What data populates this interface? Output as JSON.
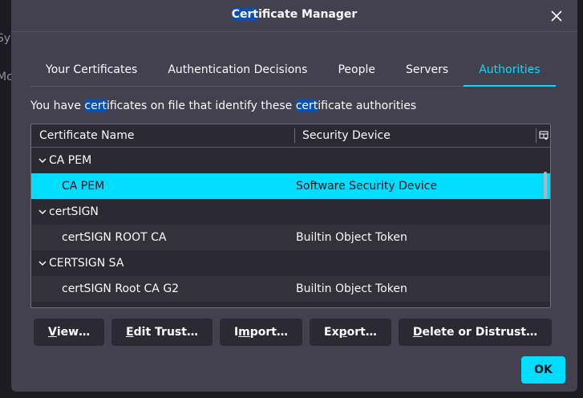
{
  "background": {
    "partial_1": "Sy",
    "partial_2": "Mc"
  },
  "dialog": {
    "title_pre": "",
    "title_hl": "Cert",
    "title_post": "ificate Manager"
  },
  "tabs": [
    {
      "label": "Your Certificates"
    },
    {
      "label": "Authentication Decisions"
    },
    {
      "label": "People"
    },
    {
      "label": "Servers"
    },
    {
      "label": "Authorities"
    }
  ],
  "intro": {
    "p1": "You have ",
    "hl1": "cert",
    "p2": "ificates on file that identify these ",
    "hl2": "cert",
    "p3": "ificate authorities"
  },
  "tree": {
    "col_name": "Certificate Name",
    "col_device": "Security Device",
    "rows": [
      {
        "name": "CA PEM",
        "device": ""
      },
      {
        "name": "CA PEM",
        "device": "Software Security Device"
      },
      {
        "name": "certSIGN",
        "device": ""
      },
      {
        "name": "certSIGN ROOT CA",
        "device": "Builtin Object Token"
      },
      {
        "name": "CERTSIGN SA",
        "device": ""
      },
      {
        "name": "certSIGN Root CA G2",
        "device": "Builtin Object Token"
      }
    ]
  },
  "buttons": {
    "view_u": "V",
    "view_rest": "iew…",
    "edit_u": "E",
    "edit_rest": "dit Trust…",
    "import_pre": "I",
    "import_u": "m",
    "import_rest": "port…",
    "export_pre": "Ex",
    "export_u": "p",
    "export_rest": "ort…",
    "delete_u": "D",
    "delete_rest": "elete or Distrust…",
    "ok": "OK"
  },
  "colors": {
    "accent": "#00ddff",
    "dialog_bg": "#42414d",
    "tree_bg": "#2b2a33",
    "highlight": "#0b4fb3"
  }
}
